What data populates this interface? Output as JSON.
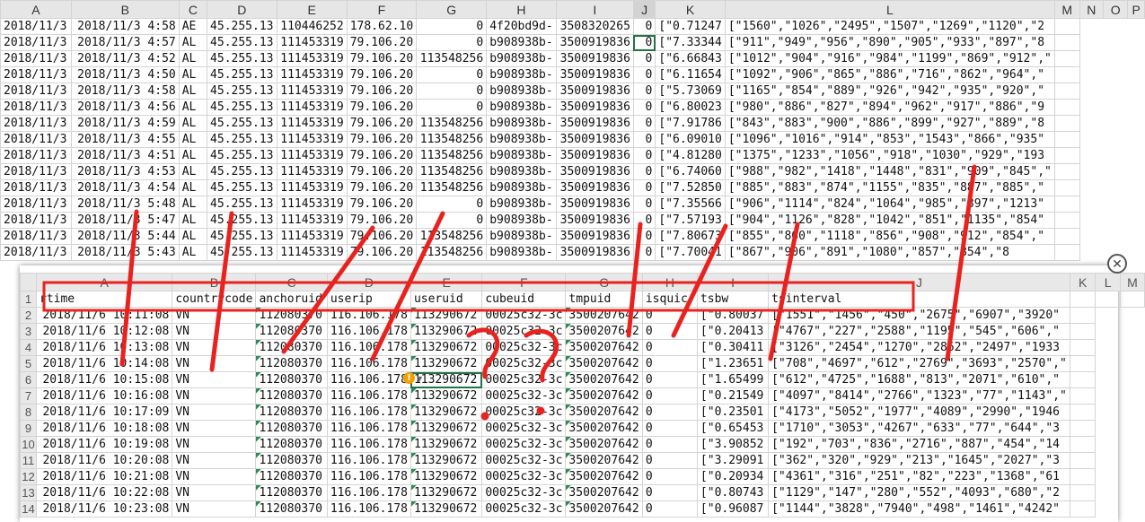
{
  "bg": {
    "columns": [
      "A",
      "B",
      "C",
      "D",
      "E",
      "F",
      "G",
      "H",
      "I",
      "J",
      "K",
      "L",
      "M",
      "N",
      "O",
      "P"
    ],
    "selected_column": "J",
    "rows": [
      [
        "2018/11/3",
        "2018/11/3 4:58",
        "AE",
        "45.255.13",
        "110446252",
        "178.62.10",
        "0",
        "4f20bd9d-",
        "3508320265",
        "0",
        "[\"0.71247",
        "[\"1560\",\"1026\",\"2495\",\"1507\",\"1269\",\"1120\",\"2",
        ""
      ],
      [
        "2018/11/3",
        "2018/11/3 4:57",
        "AL",
        "45.255.13",
        "111453319",
        "79.106.20",
        "0",
        "b908938b-",
        "3500919836",
        "0",
        "[\"7.33344",
        "[\"911\",\"949\",\"956\",\"890\",\"905\",\"933\",\"897\",\"8",
        ""
      ],
      [
        "2018/11/3",
        "2018/11/3 4:52",
        "AL",
        "45.255.13",
        "111453319",
        "79.106.20",
        "113548256",
        "b908938b-",
        "3500919836",
        "0",
        "[\"6.66843",
        "[\"1012\",\"904\",\"916\",\"984\",\"1199\",\"869\",\"912\",\"",
        ""
      ],
      [
        "2018/11/3",
        "2018/11/3 4:50",
        "AL",
        "45.255.13",
        "111453319",
        "79.106.20",
        "0",
        "b908938b-",
        "3500919836",
        "0",
        "[\"6.11654",
        "[\"1092\",\"906\",\"865\",\"886\",\"716\",\"862\",\"964\",\"",
        ""
      ],
      [
        "2018/11/3",
        "2018/11/3 4:58",
        "AL",
        "45.255.13",
        "111453319",
        "79.106.20",
        "0",
        "b908938b-",
        "3500919836",
        "0",
        "[\"5.73069",
        "[\"1165\",\"854\",\"889\",\"926\",\"942\",\"935\",\"920\",\"",
        ""
      ],
      [
        "2018/11/3",
        "2018/11/3 4:56",
        "AL",
        "45.255.13",
        "111453319",
        "79.106.20",
        "0",
        "b908938b-",
        "3500919836",
        "0",
        "[\"6.80023",
        "[\"980\",\"886\",\"827\",\"894\",\"962\",\"917\",\"886\",\"9",
        ""
      ],
      [
        "2018/11/3",
        "2018/11/3 4:59",
        "AL",
        "45.255.13",
        "111453319",
        "79.106.20",
        "113548256",
        "b908938b-",
        "3500919836",
        "0",
        "[\"7.91786",
        "[\"843\",\"883\",\"900\",\"886\",\"899\",\"927\",\"889\",\"8",
        ""
      ],
      [
        "2018/11/3",
        "2018/11/3 4:55",
        "AL",
        "45.255.13",
        "111453319",
        "79.106.20",
        "113548256",
        "b908938b-",
        "3500919836",
        "0",
        "[\"6.09010",
        "[\"1096\",\"1016\",\"914\",\"853\",\"1543\",\"866\",\"935\"",
        ""
      ],
      [
        "2018/11/3",
        "2018/11/3 4:51",
        "AL",
        "45.255.13",
        "111453319",
        "79.106.20",
        "113548256",
        "b908938b-",
        "3500919836",
        "0",
        "[\"4.81280",
        "[\"1375\",\"1233\",\"1056\",\"918\",\"1030\",\"929\",\"193",
        ""
      ],
      [
        "2018/11/3",
        "2018/11/3 4:53",
        "AL",
        "45.255.13",
        "111453319",
        "79.106.20",
        "113548256",
        "b908938b-",
        "3500919836",
        "0",
        "[\"6.74060",
        "[\"988\",\"982\",\"1418\",\"1448\",\"831\",\"909\",\"845\",\"",
        ""
      ],
      [
        "2018/11/3",
        "2018/11/3 4:54",
        "AL",
        "45.255.13",
        "111453319",
        "79.106.20",
        "113548256",
        "b908938b-",
        "3500919836",
        "0",
        "[\"7.52850",
        "[\"885\",\"883\",\"874\",\"1155\",\"835\",\"887\",\"885\",\"",
        ""
      ],
      [
        "2018/11/3",
        "2018/11/3 5:48",
        "AL",
        "45.255.13",
        "111453319",
        "79.106.20",
        "0",
        "b908938b-",
        "3500919836",
        "0",
        "[\"7.35566",
        "[\"906\",\"1114\",\"824\",\"1064\",\"985\",\"897\",\"1213\"",
        ""
      ],
      [
        "2018/11/3",
        "2018/11/3 5:47",
        "AL",
        "45.255.13",
        "111453319",
        "79.106.20",
        "0",
        "b908938b-",
        "3500919836",
        "0",
        "[\"7.57193",
        "[\"904\",\"1126\",\"828\",\"1042\",\"851\",\"1135\",\"854\"",
        ""
      ],
      [
        "2018/11/3",
        "2018/11/3 5:44",
        "AL",
        "45.255.13",
        "111453319",
        "79.106.20",
        "113548256",
        "b908938b-",
        "3500919836",
        "0",
        "[\"7.80673",
        "[\"855\",\"860\",\"1118\",\"856\",\"908\",\"912\",\"854\",\"",
        ""
      ],
      [
        "2018/11/3",
        "2018/11/3 5:43",
        "AL",
        "45.255.13",
        "111453319",
        "79.106.20",
        "113548256",
        "b908938b-",
        "3500919836",
        "0",
        "[\"7.70041",
        "[\"867\",\"906\",\"891\",\"1080\",\"857\",\"854\",\"8",
        ""
      ]
    ]
  },
  "fg": {
    "columns": [
      "A",
      "B",
      "C",
      "D",
      "E",
      "F",
      "G",
      "H",
      "I",
      "J",
      "K",
      "L",
      "M"
    ],
    "selected_column": "E",
    "headers": [
      "rtime",
      "countrycode",
      "anchoruid",
      "userip",
      "useruid",
      "cubeuid",
      "tmpuid",
      "isquic",
      "tsbw",
      "tsinterval",
      "",
      "",
      ""
    ],
    "rows": [
      [
        "2018/11/6 10:11:08",
        "VN",
        "112080370",
        "116.106.178",
        "113290672",
        "00025c32-3c",
        "3500207642",
        "0",
        "[\"0.80037",
        "[\"1551\",\"1456\",\"450\",\"2675\",\"6907\",\"3920\"",
        ""
      ],
      [
        "2018/11/6 10:12:08",
        "VN",
        "112080370",
        "116.106.178",
        "113290672",
        "00025c32-3c",
        "3500207642",
        "0",
        "[\"0.20413",
        "[\"4767\",\"227\",\"2588\",\"1195\",\"545\",\"606\",\"",
        ""
      ],
      [
        "2018/11/6 10:13:08",
        "VN",
        "112080370",
        "116.106.178",
        "113290672",
        "00025c32-3c",
        "3500207642",
        "0",
        "[\"0.30411",
        "[\"3126\",\"2454\",\"1270\",\"2862\",\"2497\",\"1933",
        ""
      ],
      [
        "2018/11/6 10:14:08",
        "VN",
        "112080370",
        "116.106.178",
        "113290672",
        "00025c32-3c",
        "3500207642",
        "0",
        "[\"1.23651",
        "[\"708\",\"4697\",\"612\",\"2769\",\"3693\",\"2570\",\"",
        ""
      ],
      [
        "2018/11/6 10:15:08",
        "VN",
        "112080370",
        "116.106.178",
        "113290672",
        "00025c32-3c",
        "3500207642",
        "0",
        "[\"1.65499",
        "[\"612\",\"4725\",\"1688\",\"813\",\"2071\",\"610\",\"",
        ""
      ],
      [
        "2018/11/6 10:16:08",
        "VN",
        "112080370",
        "116.106.178",
        "113290672",
        "00025c32-3c",
        "3500207642",
        "0",
        "[\"0.21549",
        "[\"4097\",\"8414\",\"2766\",\"1323\",\"77\",\"1143\",\"",
        ""
      ],
      [
        "2018/11/6 10:17:09",
        "VN",
        "112080370",
        "116.106.178",
        "113290672",
        "00025c32-3c",
        "3500207642",
        "0",
        "[\"0.23501",
        "[\"4173\",\"5052\",\"1977\",\"4089\",\"2990\",\"1946",
        ""
      ],
      [
        "2018/11/6 10:18:08",
        "VN",
        "112080370",
        "116.106.178",
        "113290672",
        "00025c32-3c",
        "3500207642",
        "0",
        "[\"0.65453",
        "[\"1710\",\"3053\",\"4267\",\"633\",\"77\",\"644\",\"3",
        ""
      ],
      [
        "2018/11/6 10:19:08",
        "VN",
        "112080370",
        "116.106.178",
        "113290672",
        "00025c32-3c",
        "3500207642",
        "0",
        "[\"3.90852",
        "[\"192\",\"703\",\"836\",\"2716\",\"887\",\"454\",\"14",
        ""
      ],
      [
        "2018/11/6 10:20:08",
        "VN",
        "112080370",
        "116.106.178",
        "113290672",
        "00025c32-3c",
        "3500207642",
        "0",
        "[\"3.29091",
        "[\"362\",\"320\",\"929\",\"213\",\"1645\",\"2027\",\"3",
        ""
      ],
      [
        "2018/11/6 10:21:08",
        "VN",
        "112080370",
        "116.106.178",
        "113290672",
        "00025c32-3c",
        "3500207642",
        "0",
        "[\"0.20934",
        "[\"4361\",\"316\",\"251\",\"82\",\"223\",\"1368\",\"61",
        ""
      ],
      [
        "2018/11/6 10:22:08",
        "VN",
        "112080370",
        "116.106.178",
        "113290672",
        "00025c32-3c",
        "3500207642",
        "0",
        "[\"0.80743",
        "[\"1129\",\"147\",\"280\",\"552\",\"4093\",\"680\",\"2",
        ""
      ],
      [
        "2018/11/6 10:23:08",
        "VN",
        "112080370",
        "116.106.178",
        "113290672",
        "00025c32-3c",
        "3500207642",
        "0",
        "[\"0.96087",
        "[\"1144\",\"3828\",\"7940\",\"498\",\"1461\",\"4242\"",
        ""
      ]
    ]
  },
  "annotations": {
    "question_mark": "?"
  },
  "icons": {
    "close": "close-icon",
    "warning": "warning-icon"
  },
  "colors": {
    "accent": "#217346",
    "pen": "#e8231f"
  }
}
